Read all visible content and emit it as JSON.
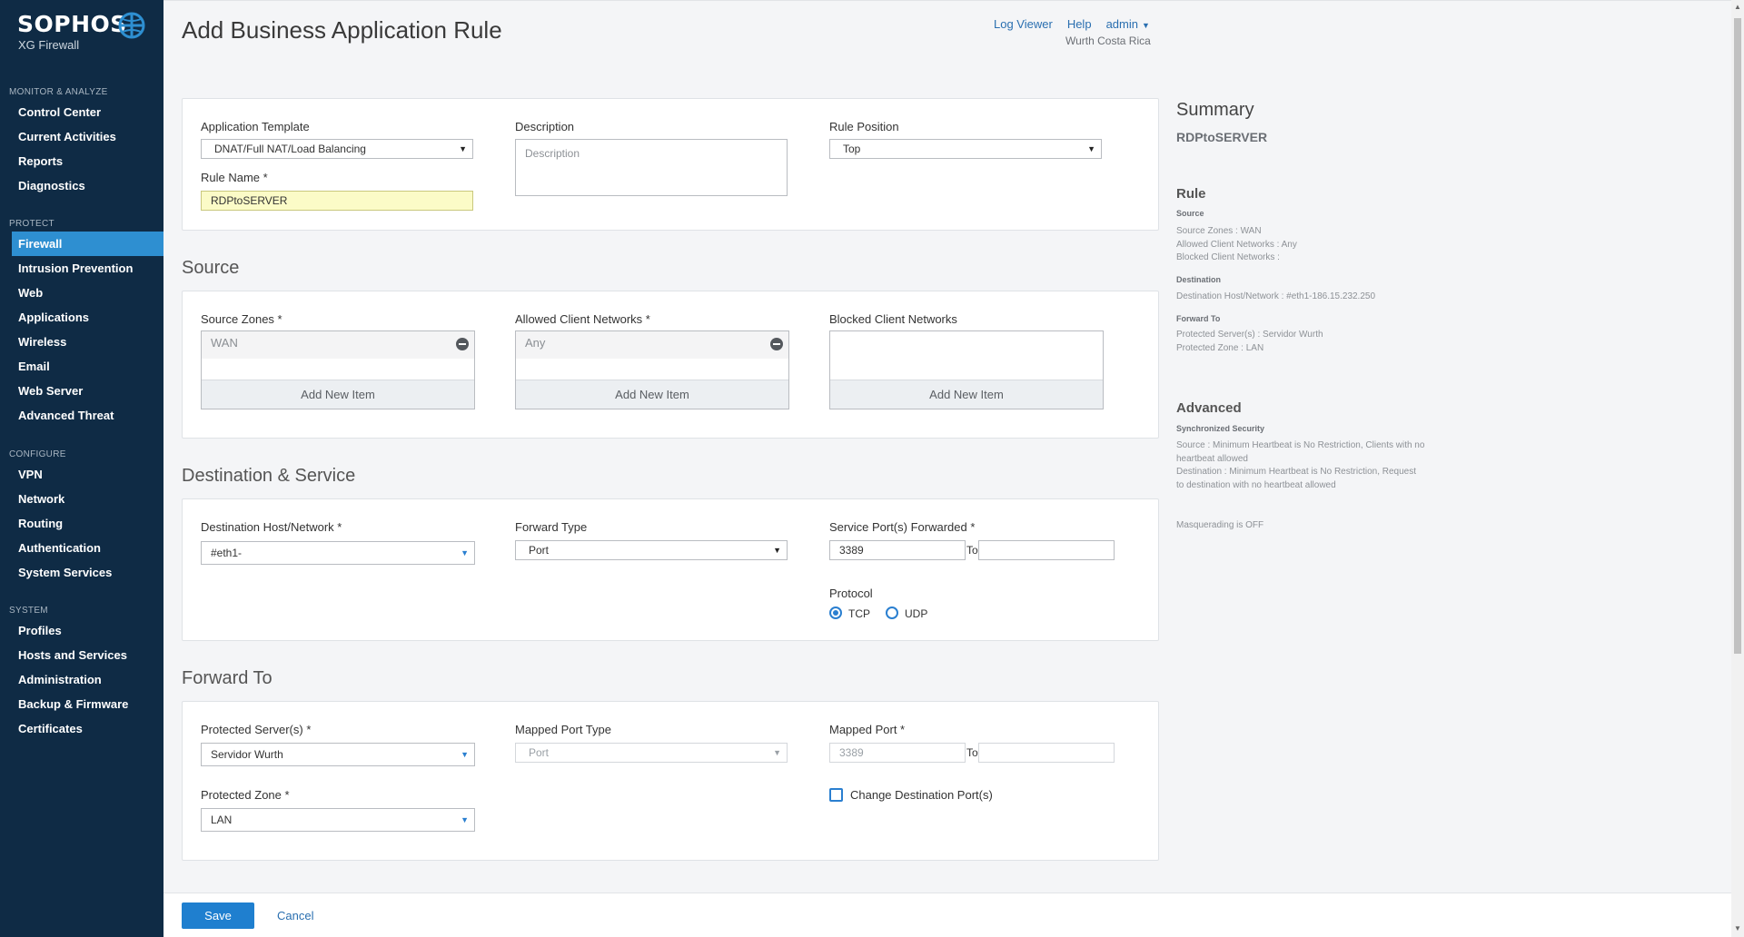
{
  "brand": {
    "name": "SOPHOS",
    "product": "XG Firewall"
  },
  "nav": [
    {
      "heading": "MONITOR & ANALYZE",
      "items": [
        "Control Center",
        "Current Activities",
        "Reports",
        "Diagnostics"
      ]
    },
    {
      "heading": "PROTECT",
      "items": [
        "Firewall",
        "Intrusion Prevention",
        "Web",
        "Applications",
        "Wireless",
        "Email",
        "Web Server",
        "Advanced Threat"
      ]
    },
    {
      "heading": "CONFIGURE",
      "items": [
        "VPN",
        "Network",
        "Routing",
        "Authentication",
        "System Services"
      ]
    },
    {
      "heading": "SYSTEM",
      "items": [
        "Profiles",
        "Hosts and Services",
        "Administration",
        "Backup & Firmware",
        "Certificates"
      ]
    }
  ],
  "active_nav": "Firewall",
  "header": {
    "title": "Add Business Application Rule",
    "log_viewer": "Log Viewer",
    "help": "Help",
    "user": "admin",
    "org": "Wurth Costa Rica"
  },
  "general": {
    "app_template_label": "Application Template",
    "app_template_value": "DNAT/Full NAT/Load Balancing",
    "rule_name_label": "Rule Name *",
    "rule_name_value": "RDPtoSERVER",
    "description_label": "Description",
    "description_placeholder": "Description",
    "rule_position_label": "Rule Position",
    "rule_position_value": "Top"
  },
  "source": {
    "title": "Source",
    "zones_label": "Source Zones *",
    "zones_value": "WAN",
    "allowed_label": "Allowed Client Networks *",
    "allowed_value": "Any",
    "blocked_label": "Blocked Client Networks",
    "add_new_item": "Add New Item"
  },
  "destination": {
    "title": "Destination & Service",
    "host_label": "Destination Host/Network *",
    "host_value": "#eth1-",
    "forward_type_label": "Forward Type",
    "forward_type_value": "Port",
    "ports_label": "Service Port(s) Forwarded *",
    "port_from": "3389",
    "to_label": "To",
    "protocol_label": "Protocol",
    "protocol_options": [
      "TCP",
      "UDP"
    ],
    "protocol_selected": "TCP"
  },
  "forward": {
    "title": "Forward To",
    "server_label": "Protected Server(s) *",
    "server_value": "Servidor Wurth",
    "mapped_type_label": "Mapped Port Type",
    "mapped_type_value": "Port",
    "mapped_port_label": "Mapped Port *",
    "mapped_port_value": "3389",
    "to_label": "To",
    "zone_label": "Protected Zone *",
    "zone_value": "LAN",
    "change_dest_label": "Change Destination Port(s)",
    "change_dest_checked": false
  },
  "summary": {
    "title": "Summary",
    "rule_name": "RDPtoSERVER",
    "rule_heading": "Rule",
    "source_heading": "Source",
    "source_lines": [
      "Source Zones : WAN",
      "Allowed Client Networks : Any",
      "Blocked Client Networks :"
    ],
    "destination_heading": "Destination",
    "destination_lines": [
      "Destination Host/Network : #eth1-186.15.232.250"
    ],
    "forward_heading": "Forward To",
    "forward_lines": [
      "Protected Server(s) : Servidor Wurth",
      "Protected Zone : LAN"
    ],
    "advanced_heading": "Advanced",
    "sync_heading": "Synchronized Security",
    "sync_lines": [
      "Source : Minimum Heartbeat is No Restriction, Clients with no",
      "heartbeat allowed",
      "Destination : Minimum Heartbeat is No Restriction, Request",
      "to destination with no heartbeat allowed"
    ],
    "masquerading": "Masquerading is OFF"
  },
  "footer": {
    "save": "Save",
    "cancel": "Cancel"
  },
  "colors": {
    "sidebar": "#0f2b45",
    "accent": "#2e8fd1",
    "primary_button": "#1f7fcf",
    "link": "#2a6fb0"
  }
}
